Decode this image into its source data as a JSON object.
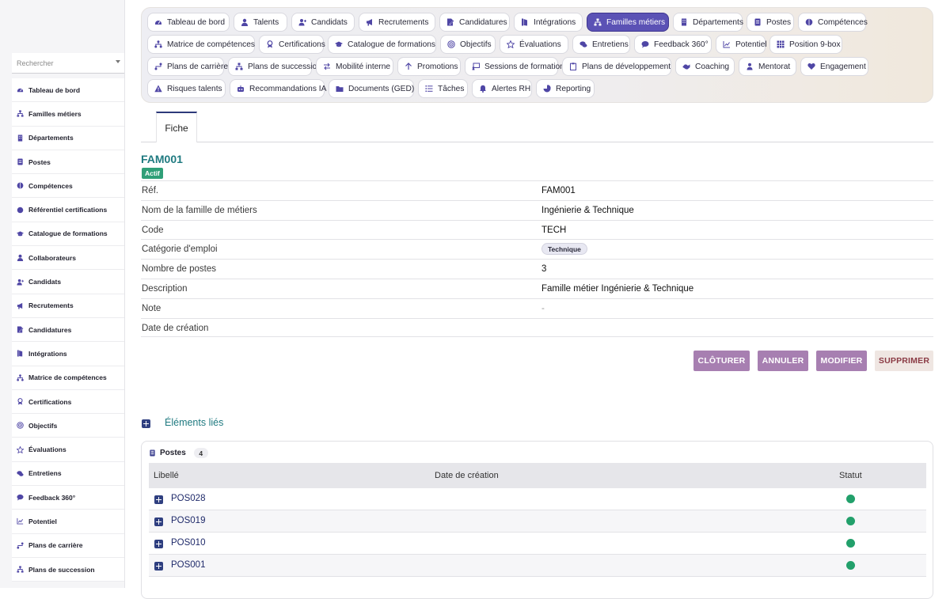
{
  "sidebar": {
    "search_placeholder": "Rechercher",
    "items": [
      {
        "label": "Tableau de bord",
        "icon": "dashboard-icon"
      },
      {
        "label": "Familles métiers",
        "icon": "hierarchy-icon"
      },
      {
        "label": "Départements",
        "icon": "building-icon"
      },
      {
        "label": "Postes",
        "icon": "badge-icon"
      },
      {
        "label": "Compétences",
        "icon": "brain-icon"
      },
      {
        "label": "Référentiel certifications",
        "icon": "certificate-icon"
      },
      {
        "label": "Catalogue de formations",
        "icon": "graduation-cap-icon"
      },
      {
        "label": "Collaborateurs",
        "icon": "user-icon"
      },
      {
        "label": "Candidats",
        "icon": "user-plus-icon"
      },
      {
        "label": "Recrutements",
        "icon": "megaphone-icon"
      },
      {
        "label": "Candidatures",
        "icon": "file-pen-icon"
      },
      {
        "label": "Intégrations",
        "icon": "door-icon"
      },
      {
        "label": "Matrice de compétences",
        "icon": "sitemap-icon"
      },
      {
        "label": "Certifications",
        "icon": "award-icon"
      },
      {
        "label": "Objectifs",
        "icon": "target-icon"
      },
      {
        "label": "Évaluations",
        "icon": "star-icon"
      },
      {
        "label": "Entretiens",
        "icon": "chat-icon"
      },
      {
        "label": "Feedback 360°",
        "icon": "comment-icon"
      },
      {
        "label": "Potentiel",
        "icon": "chart-line-icon"
      },
      {
        "label": "Plans de carrière",
        "icon": "route-icon"
      },
      {
        "label": "Plans de succession",
        "icon": "hierarchy-icon"
      }
    ]
  },
  "nav": {
    "buttons": [
      {
        "label": "Tableau de bord",
        "icon": "dashboard-icon",
        "active": false
      },
      {
        "label": "Talents",
        "icon": "user-icon",
        "active": false
      },
      {
        "label": "Candidats",
        "icon": "user-plus-icon",
        "active": false
      },
      {
        "label": "Recrutements",
        "icon": "megaphone-icon",
        "active": false
      },
      {
        "label": "Candidatures",
        "icon": "file-pen-icon",
        "active": false
      },
      {
        "label": "Intégrations",
        "icon": "door-icon",
        "active": false
      },
      {
        "label": "Familles métiers",
        "icon": "hierarchy-icon",
        "active": true
      },
      {
        "label": "Départements",
        "icon": "building-icon",
        "active": false
      },
      {
        "label": "Postes",
        "icon": "badge-icon",
        "active": false
      },
      {
        "label": "Compétences",
        "icon": "brain-icon",
        "active": false
      },
      {
        "label": "Matrice de compétences",
        "icon": "sitemap-icon",
        "active": false
      },
      {
        "label": "Certifications",
        "icon": "award-icon",
        "active": false
      },
      {
        "label": "Catalogue de formations",
        "icon": "graduation-cap-icon",
        "active": false
      },
      {
        "label": "Objectifs",
        "icon": "target-icon",
        "active": false
      },
      {
        "label": "Évaluations",
        "icon": "star-icon",
        "active": false
      },
      {
        "label": "Entretiens",
        "icon": "chat-icon",
        "active": false
      },
      {
        "label": "Feedback 360°",
        "icon": "comment-icon",
        "active": false
      },
      {
        "label": "Potentiel",
        "icon": "chart-line-icon",
        "active": false
      },
      {
        "label": "Position 9-box",
        "icon": "grid-icon",
        "active": false
      },
      {
        "label": "Plans de carrière",
        "icon": "route-icon",
        "active": false
      },
      {
        "label": "Plans de succession",
        "icon": "hierarchy-icon",
        "active": false
      },
      {
        "label": "Mobilité interne",
        "icon": "arrows-icon",
        "active": false
      },
      {
        "label": "Promotions",
        "icon": "arrow-up-icon",
        "active": false
      },
      {
        "label": "Sessions de formation",
        "icon": "presentation-icon",
        "active": false
      },
      {
        "label": "Plans de développement",
        "icon": "clipboard-icon",
        "active": false
      },
      {
        "label": "Coaching",
        "icon": "handshake-icon",
        "active": false
      },
      {
        "label": "Mentorat",
        "icon": "mentor-icon",
        "active": false
      },
      {
        "label": "Engagement",
        "icon": "heart-icon",
        "active": false
      },
      {
        "label": "Risques talents",
        "icon": "warning-icon",
        "active": false
      },
      {
        "label": "Recommandations IA",
        "icon": "robot-icon",
        "active": false
      },
      {
        "label": "Documents (GED)",
        "icon": "folder-icon",
        "active": false
      },
      {
        "label": "Tâches",
        "icon": "tasks-icon",
        "active": false
      },
      {
        "label": "Alertes RH",
        "icon": "bell-icon",
        "active": false
      },
      {
        "label": "Reporting",
        "icon": "pie-chart-icon",
        "active": false
      }
    ]
  },
  "tabs": {
    "fiche": "Fiche"
  },
  "record": {
    "ref": "FAM001",
    "status": "Actif",
    "fields": [
      {
        "label": "Réf.",
        "value": "FAM001",
        "type": "text"
      },
      {
        "label": "Nom de la famille de métiers",
        "value": "Ingénierie & Technique",
        "type": "text"
      },
      {
        "label": "Code",
        "value": "TECH",
        "type": "text"
      },
      {
        "label": "Catégorie d'emploi",
        "value": "Technique",
        "type": "chip"
      },
      {
        "label": "Nombre de postes",
        "value": "3",
        "type": "text"
      },
      {
        "label": "Description",
        "value": "Famille métier Ingénierie & Technique",
        "type": "text"
      },
      {
        "label": "Note",
        "value": "-",
        "type": "dash"
      },
      {
        "label": "Date de création",
        "value": "",
        "type": "text"
      }
    ]
  },
  "actions": {
    "cloturer": "CLÔTURER",
    "annuler": "ANNULER",
    "modifier": "MODIFIER",
    "supprimer": "SUPPRIMER"
  },
  "related": {
    "title": "Éléments liés",
    "postes": {
      "title": "Postes",
      "count": "4",
      "columns": {
        "libelle": "Libellé",
        "date": "Date de création",
        "statut": "Statut"
      },
      "rows": [
        {
          "label": "POS028",
          "status_color": "#22a06b"
        },
        {
          "label": "POS019",
          "status_color": "#22a06b"
        },
        {
          "label": "POS010",
          "status_color": "#22a06b"
        },
        {
          "label": "POS001",
          "status_color": "#22a06b"
        }
      ]
    }
  },
  "colors": {
    "accent": "#5b52b5",
    "teal": "#1f7a80",
    "status_green": "#22a06b",
    "action": "#a77fb1"
  }
}
